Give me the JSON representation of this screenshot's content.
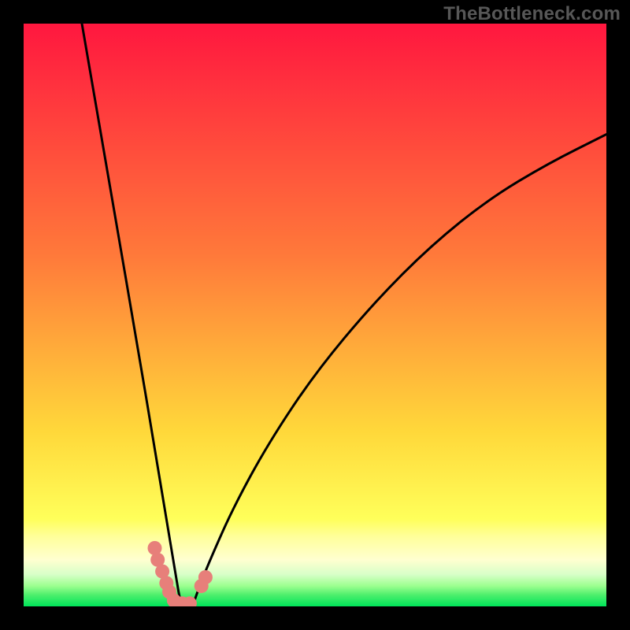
{
  "watermark": "TheBottleneck.com",
  "colors": {
    "frame": "#000000",
    "gradient_top": "#ff173f",
    "gradient_mid1": "#ff7a3a",
    "gradient_mid2": "#ffd83a",
    "gradient_band_light": "#ffff9a",
    "gradient_band_green_light": "#9cff8f",
    "gradient_bottom": "#00e459",
    "curve": "#000000",
    "marker": "#e77f7a"
  },
  "chart_data": {
    "type": "line",
    "title": "",
    "xlabel": "",
    "ylabel": "",
    "xlim": [
      0,
      100
    ],
    "ylim": [
      0,
      100
    ],
    "grid": false,
    "optimum_x": 27,
    "note": "V-shaped bottleneck curve. x is normalized position across plot width (0–100). y is normalized height (0 = bottom/green, 100 = top/red). Minimum (0 mismatch) near x≈27.",
    "series": [
      {
        "name": "bottleneck-curve",
        "x": [
          10,
          15,
          20,
          22,
          24,
          25,
          26,
          27,
          28,
          29,
          30,
          32,
          36,
          42,
          50,
          60,
          70,
          80,
          90,
          100
        ],
        "y": [
          100,
          71,
          42,
          30,
          18,
          12,
          6,
          0,
          0,
          0,
          3,
          8,
          17,
          28,
          40,
          52,
          62,
          70,
          76,
          81
        ]
      }
    ],
    "markers": {
      "name": "sample-points",
      "description": "Pink dots clustered near the bottom of the V",
      "x": [
        22.5,
        23.0,
        23.8,
        24.5,
        25.0,
        25.8,
        26.5,
        27.2,
        28.5,
        30.5,
        31.2
      ],
      "y": [
        10.0,
        8.0,
        6.0,
        4.0,
        2.5,
        1.0,
        0.5,
        0.5,
        0.5,
        3.5,
        5.0
      ]
    }
  }
}
